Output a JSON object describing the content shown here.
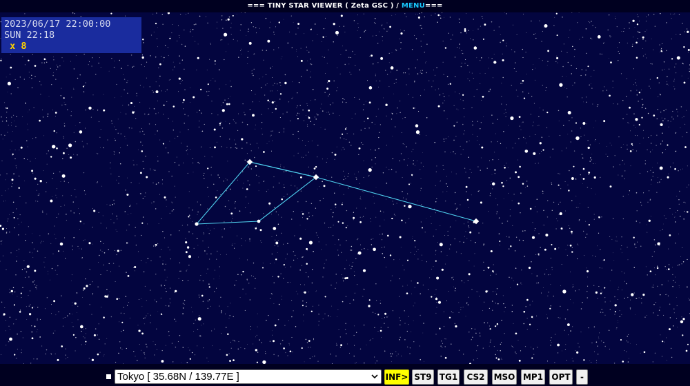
{
  "header": {
    "title_prefix": "=== TINY STAR VIEWER ( Zeta GSC ) / ",
    "menu_label": "MENU",
    "title_suffix": "==="
  },
  "info": {
    "datetime": "2023/06/17 22:00:00",
    "sidereal": "SUN 22:18",
    "zoom": " x 8"
  },
  "sky": {
    "background_color": "#03053f",
    "star_color": "#ffffff",
    "constellation_line_color": "#4fd2f0"
  },
  "footer": {
    "location": "Tokyo [ 35.68N / 139.77E ]",
    "buttons": [
      {
        "label": "INF>",
        "active": true
      },
      {
        "label": "ST9",
        "active": false
      },
      {
        "label": "TG1",
        "active": false
      },
      {
        "label": "CS2",
        "active": false
      },
      {
        "label": "MSO",
        "active": false
      },
      {
        "label": "MP1",
        "active": false
      },
      {
        "label": "OPT",
        "active": false
      },
      {
        "label": "-",
        "active": false
      }
    ]
  },
  "colors": {
    "accent_menu": "#19c8ff",
    "info_box_bg": "#1a2c9e",
    "zoom_text": "#ffd200",
    "active_button": "#ffff00"
  }
}
